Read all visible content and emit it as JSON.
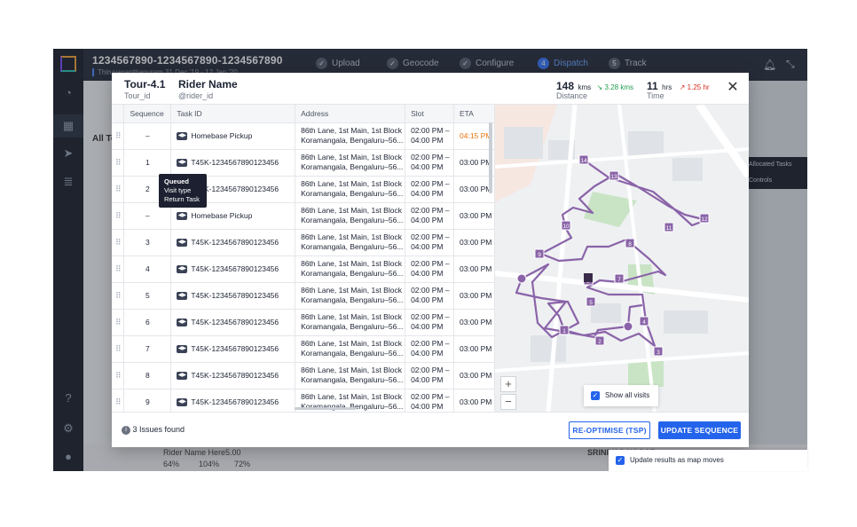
{
  "app": {
    "title": "1234567890-1234567890-1234567890",
    "subtitle": "Thiruvananthapuram  31 Dec '19 - 12 Jan '20",
    "steps": [
      {
        "num": "",
        "label": "Upload",
        "status": "done"
      },
      {
        "num": "",
        "label": "Geocode",
        "status": "done"
      },
      {
        "num": "",
        "label": "Configure",
        "status": "done"
      },
      {
        "num": "4",
        "label": "Dispatch",
        "status": "current"
      },
      {
        "num": "5",
        "label": "Track",
        "status": "todo"
      }
    ],
    "left_tab": "All To",
    "right_labels": [
      "Allocated Tasks",
      "Controls"
    ],
    "bottom": {
      "rider": "Rider Name Here",
      "rating": "5.00",
      "pct1": "64%",
      "pct2": "104%",
      "pct3": "72%",
      "place": "SRINIVAS NAGAR"
    }
  },
  "modal": {
    "tour_title": "Tour-4.1",
    "tour_sub": "Tour_id",
    "rider_title": "Rider Name",
    "rider_sub": "@rider_id",
    "distance_value": "148",
    "distance_unit": "kms",
    "distance_delta": "3.28 kms",
    "distance_label": "Distance",
    "time_value": "11",
    "time_unit": "hrs",
    "time_delta": "1.25 hr",
    "time_label": "Time",
    "colors": {
      "accent": "#2463eb",
      "positive": "#1f9d4c",
      "negative": "#d92d20",
      "late": "#e8740c",
      "route": "#8a63a8"
    },
    "columns": [
      "Sequence",
      "Task ID",
      "Address",
      "Slot",
      "ETA"
    ],
    "rows": [
      {
        "seq": "–",
        "task": "Homebase Pickup",
        "addr1": "86th Lane, 1st Main, 1st Block",
        "addr2": "Koramangala, Bengaluru–56...",
        "slot1": "02:00 PM –",
        "slot2": "04:00 PM",
        "eta": "04:15 PM",
        "late": true
      },
      {
        "seq": "1",
        "task": "T45K-1234567890123456",
        "addr1": "86th Lane, 1st Main, 1st Block",
        "addr2": "Koramangala, Bengaluru–56...",
        "slot1": "02:00 PM –",
        "slot2": "04:00 PM",
        "eta": "03:00 PM",
        "late": false
      },
      {
        "seq": "2",
        "task": "T45K-1234567890123456",
        "addr1": "86th Lane, 1st Main, 1st Block",
        "addr2": "Koramangala, Bengaluru–56...",
        "slot1": "02:00 PM –",
        "slot2": "04:00 PM",
        "eta": "03:00 PM",
        "late": false
      },
      {
        "seq": "–",
        "task": "Homebase Pickup",
        "addr1": "86th Lane, 1st Main, 1st Block",
        "addr2": "Koramangala, Bengaluru–56...",
        "slot1": "02:00 PM –",
        "slot2": "04:00 PM",
        "eta": "03:00 PM",
        "late": false
      },
      {
        "seq": "3",
        "task": "T45K-1234567890123456",
        "addr1": "86th Lane, 1st Main, 1st Block",
        "addr2": "Koramangala, Bengaluru–56...",
        "slot1": "02:00 PM –",
        "slot2": "04:00 PM",
        "eta": "03:00 PM",
        "late": false
      },
      {
        "seq": "4",
        "task": "T45K-1234567890123456",
        "addr1": "86th Lane, 1st Main, 1st Block",
        "addr2": "Koramangala, Bengaluru–56...",
        "slot1": "02:00 PM –",
        "slot2": "04:00 PM",
        "eta": "03:00 PM",
        "late": false
      },
      {
        "seq": "5",
        "task": "T45K-1234567890123456",
        "addr1": "86th Lane, 1st Main, 1st Block",
        "addr2": "Koramangala, Bengaluru–56...",
        "slot1": "02:00 PM –",
        "slot2": "04:00 PM",
        "eta": "03:00 PM",
        "late": false
      },
      {
        "seq": "6",
        "task": "T45K-1234567890123456",
        "addr1": "86th Lane, 1st Main, 1st Block",
        "addr2": "Koramangala, Bengaluru–56...",
        "slot1": "02:00 PM –",
        "slot2": "04:00 PM",
        "eta": "03:00 PM",
        "late": false
      },
      {
        "seq": "7",
        "task": "T45K-1234567890123456",
        "addr1": "86th Lane, 1st Main, 1st Block",
        "addr2": "Koramangala, Bengaluru–56...",
        "slot1": "02:00 PM –",
        "slot2": "04:00 PM",
        "eta": "03:00 PM",
        "late": false
      },
      {
        "seq": "8",
        "task": "T45K-1234567890123456",
        "addr1": "86th Lane, 1st Main, 1st Block",
        "addr2": "Koramangala, Bengaluru–56...",
        "slot1": "02:00 PM –",
        "slot2": "04:00 PM",
        "eta": "03:00 PM",
        "late": false
      },
      {
        "seq": "9",
        "task": "T45K-1234567890123456",
        "addr1": "86th Lane, 1st Main, 1st Block",
        "addr2": "Koramangala, Bengaluru–56...",
        "slot1": "02:00 PM –",
        "slot2": "04:00 PM",
        "eta": "03:00 PM",
        "late": false
      }
    ],
    "tooltip": [
      "Queued",
      "Visit type",
      "Return Task"
    ],
    "show_all_label": "Show all visits",
    "issues_label": "3 Issues found",
    "reoptimise_label": "RE-OPTIMISE (TSP)",
    "update_label": "UPDATE SEQUENCE",
    "map_markers": [
      "1",
      "2",
      "3",
      "4",
      "5",
      "6",
      "7",
      "8",
      "9",
      "10",
      "11",
      "12",
      "13",
      "14"
    ]
  },
  "update_results_label": "Update results as map moves"
}
